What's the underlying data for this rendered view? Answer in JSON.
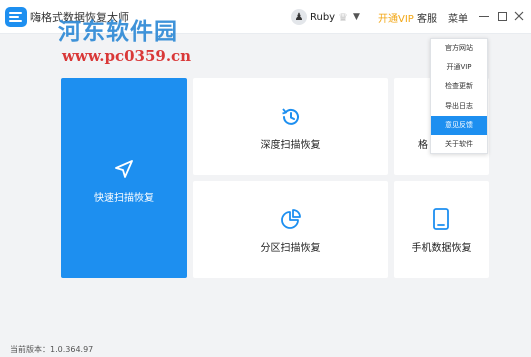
{
  "app": {
    "title": "嗨格式数据恢复大师",
    "watermark_text": "河东软件园",
    "watermark_url": "www.pc0359.cn"
  },
  "header": {
    "user_name": "Ruby",
    "vip_label": "开通VIP",
    "service_label": "客服",
    "menu_label": "菜单",
    "accent_color": "#f2a614"
  },
  "menu": {
    "items": [
      {
        "label": "官方网站"
      },
      {
        "label": "开通VIP"
      },
      {
        "label": "检查更新"
      },
      {
        "label": "导出日志"
      },
      {
        "label": "意见反馈",
        "active": true
      },
      {
        "label": "关于软件"
      }
    ]
  },
  "cards": {
    "quick_scan": "快速扫描恢复",
    "deep_scan": "深度扫描恢复",
    "format_scan": "格",
    "partition_scan": "分区扫描恢复",
    "phone_recovery": "手机数据恢复"
  },
  "colors": {
    "primary": "#1d8ff0",
    "background": "#f2f3f5"
  },
  "footer": {
    "version": "当前版本：1.0.364.97"
  }
}
